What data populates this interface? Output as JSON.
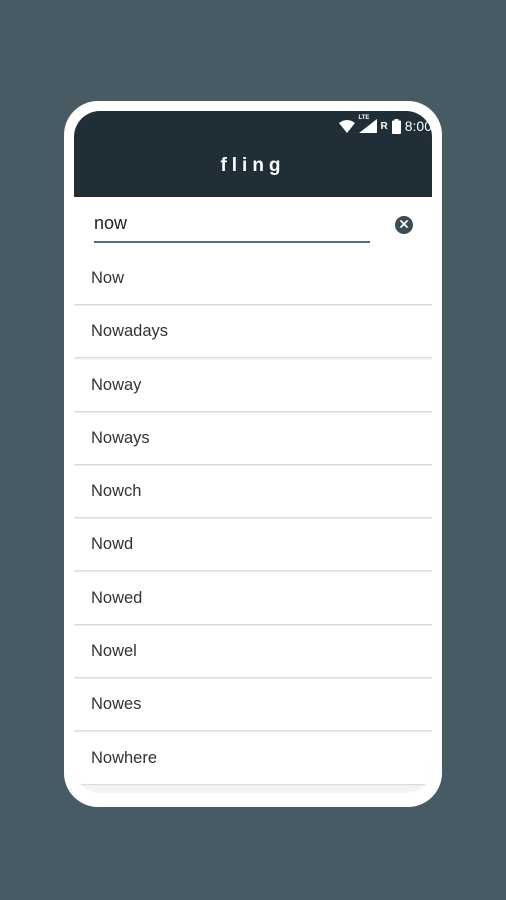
{
  "app": {
    "title": "fling"
  },
  "status_bar": {
    "network_label": "LTE",
    "roaming_label": "R",
    "time": "8:00"
  },
  "search": {
    "value": "now",
    "clear_icon": "clear-circle-icon"
  },
  "results": [
    {
      "label": "Now"
    },
    {
      "label": "Nowadays"
    },
    {
      "label": "Noway"
    },
    {
      "label": "Noways"
    },
    {
      "label": "Nowch"
    },
    {
      "label": "Nowd"
    },
    {
      "label": "Nowed"
    },
    {
      "label": "Nowel"
    },
    {
      "label": "Nowes"
    },
    {
      "label": "Nowhere"
    }
  ],
  "colors": {
    "background": "#485a64",
    "app_bar": "#1f2e37",
    "accent_underline": "#5a6f7c"
  }
}
